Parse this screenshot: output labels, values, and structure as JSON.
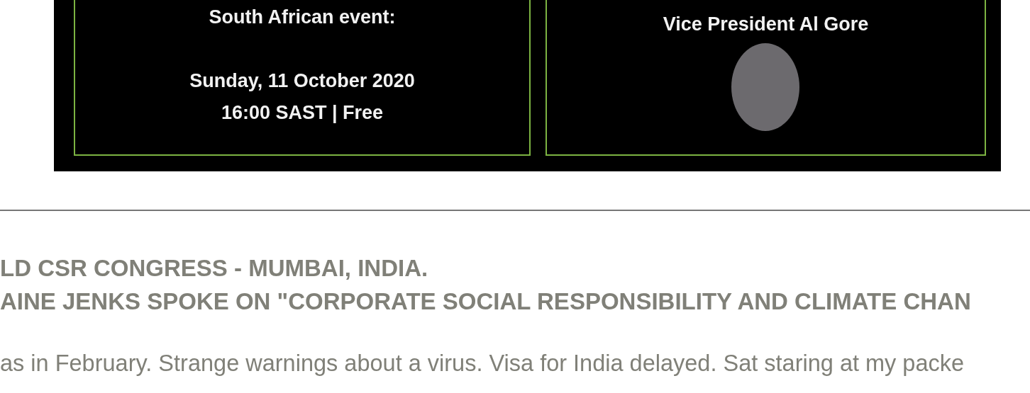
{
  "banner": {
    "left_panel": {
      "title": "South African event:",
      "details": [
        "Sunday, 11 October 2020",
        "16:00 SAST | Free"
      ]
    },
    "right_panel": {
      "lines": [
        "Vice President Al Gore"
      ]
    }
  },
  "article": {
    "heading_lines": [
      "LD CSR CONGRESS - MUMBAI, INDIA.",
      "AINE JENKS SPOKE ON \"CORPORATE SOCIAL RESPONSIBILITY AND CLIMATE CHAN"
    ],
    "body_line": "as in February. Strange warnings about a virus. Visa for India delayed. Sat staring at my packe"
  }
}
